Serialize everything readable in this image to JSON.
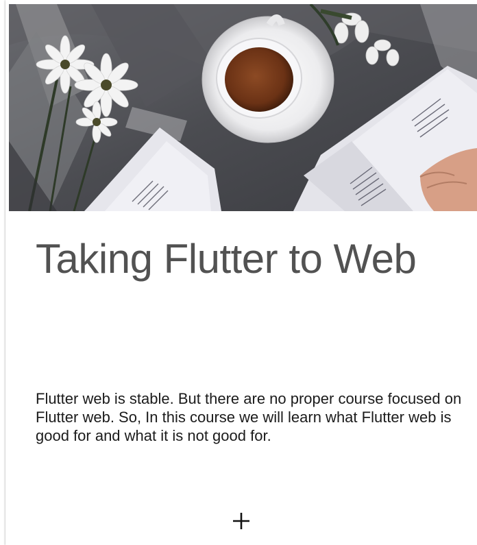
{
  "course_card": {
    "image": {
      "icon": "cover-photo-tea-and-papers",
      "colors": {
        "table": "#4b4c51",
        "cup": "#f2f2f4",
        "tea": "#7a3d1e",
        "paper": "#e9e9ee",
        "flower": "#f4f4f4"
      }
    },
    "title": "Taking Flutter to Web",
    "description": "Flutter web is stable. But there are no proper course focused on Flutter web. So, In this course we will learn what Flutter web is good for and what it is not good for.",
    "add_button": {
      "icon": "plus-icon",
      "label": "+"
    }
  }
}
